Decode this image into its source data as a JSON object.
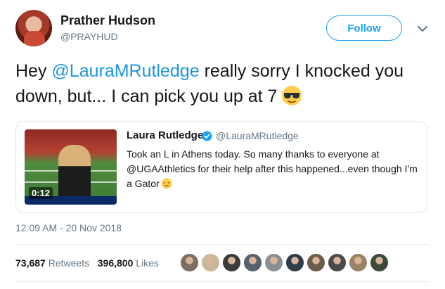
{
  "author": {
    "name": "Prather Hudson",
    "handle": "@PRAYHUD",
    "avatar_icon": "profile-photo"
  },
  "follow_label": "Follow",
  "more_icon": "chevron-down-icon",
  "tweet": {
    "text_before": "Hey ",
    "mention": "@LauraMRutledge",
    "text_after": " really sorry I knocked you down, but... I can pick you up at 7",
    "emoji": "sunglasses-emoji"
  },
  "quoted": {
    "video_time": "0:12",
    "name": "Laura Rutledge",
    "handle": "@LauraMRutledge",
    "verified": true,
    "body": "Took an L in Athens today. So many thanks to everyone at @UGAAthletics for their help after this happened...even though I'm a Gator",
    "emoji": "relieved-face-emoji"
  },
  "timestamp": "12:09 AM - 20 Nov 2018",
  "stats": {
    "retweets_count": "73,687",
    "retweets_label": "Retweets",
    "likes_count": "396,800",
    "likes_label": "Likes"
  },
  "likers": [
    "#7a6f62",
    "#c9b79b",
    "#3b3b3b",
    "#556070",
    "#8a8f96",
    "#2e3c4c",
    "#6b5b48",
    "#4a4a4a",
    "#9a8465",
    "#3d4a3a"
  ],
  "colors": {
    "accent": "#1da1f2",
    "mention": "#1b95e0",
    "muted": "#657786"
  }
}
